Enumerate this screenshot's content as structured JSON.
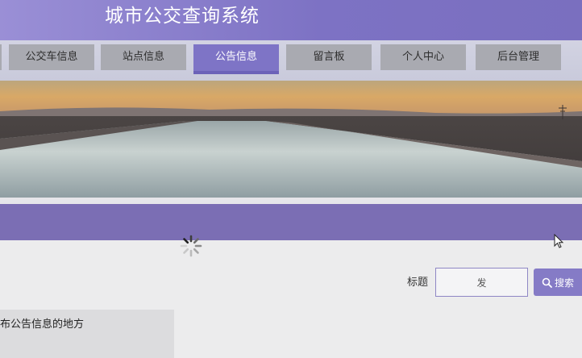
{
  "header": {
    "title": "城市公交查询系统"
  },
  "nav": {
    "items": [
      {
        "label": "公交车信息"
      },
      {
        "label": "站点信息"
      },
      {
        "label": "公告信息",
        "active": true
      },
      {
        "label": "留言板"
      },
      {
        "label": "个人中心"
      },
      {
        "label": "后台管理"
      }
    ]
  },
  "search": {
    "label": "标题",
    "value": "发",
    "button_label": "搜索"
  },
  "notice": {
    "text": "布公告信息的地方"
  },
  "colors": {
    "header": "#7d72c4",
    "nav_active": "#7e74c6",
    "band": "#7b6eb4",
    "button": "#857bc6"
  }
}
